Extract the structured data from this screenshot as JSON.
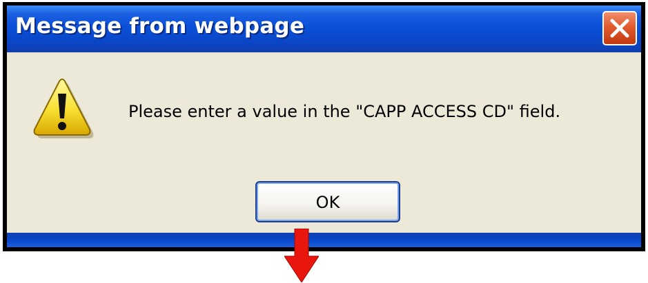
{
  "dialog": {
    "title": "Message from webpage",
    "message": "Please enter a value in the \"CAPP ACCESS CD\" field.",
    "ok_label": "OK",
    "icon": "warning-icon",
    "close_icon": "close-icon"
  },
  "annotation": {
    "arrow_icon": "down-arrow-icon",
    "arrow_color": "#e8160c"
  },
  "colors": {
    "title_bar": "#0a50d8",
    "body": "#ece9d8",
    "close_button": "#e25a2e"
  }
}
